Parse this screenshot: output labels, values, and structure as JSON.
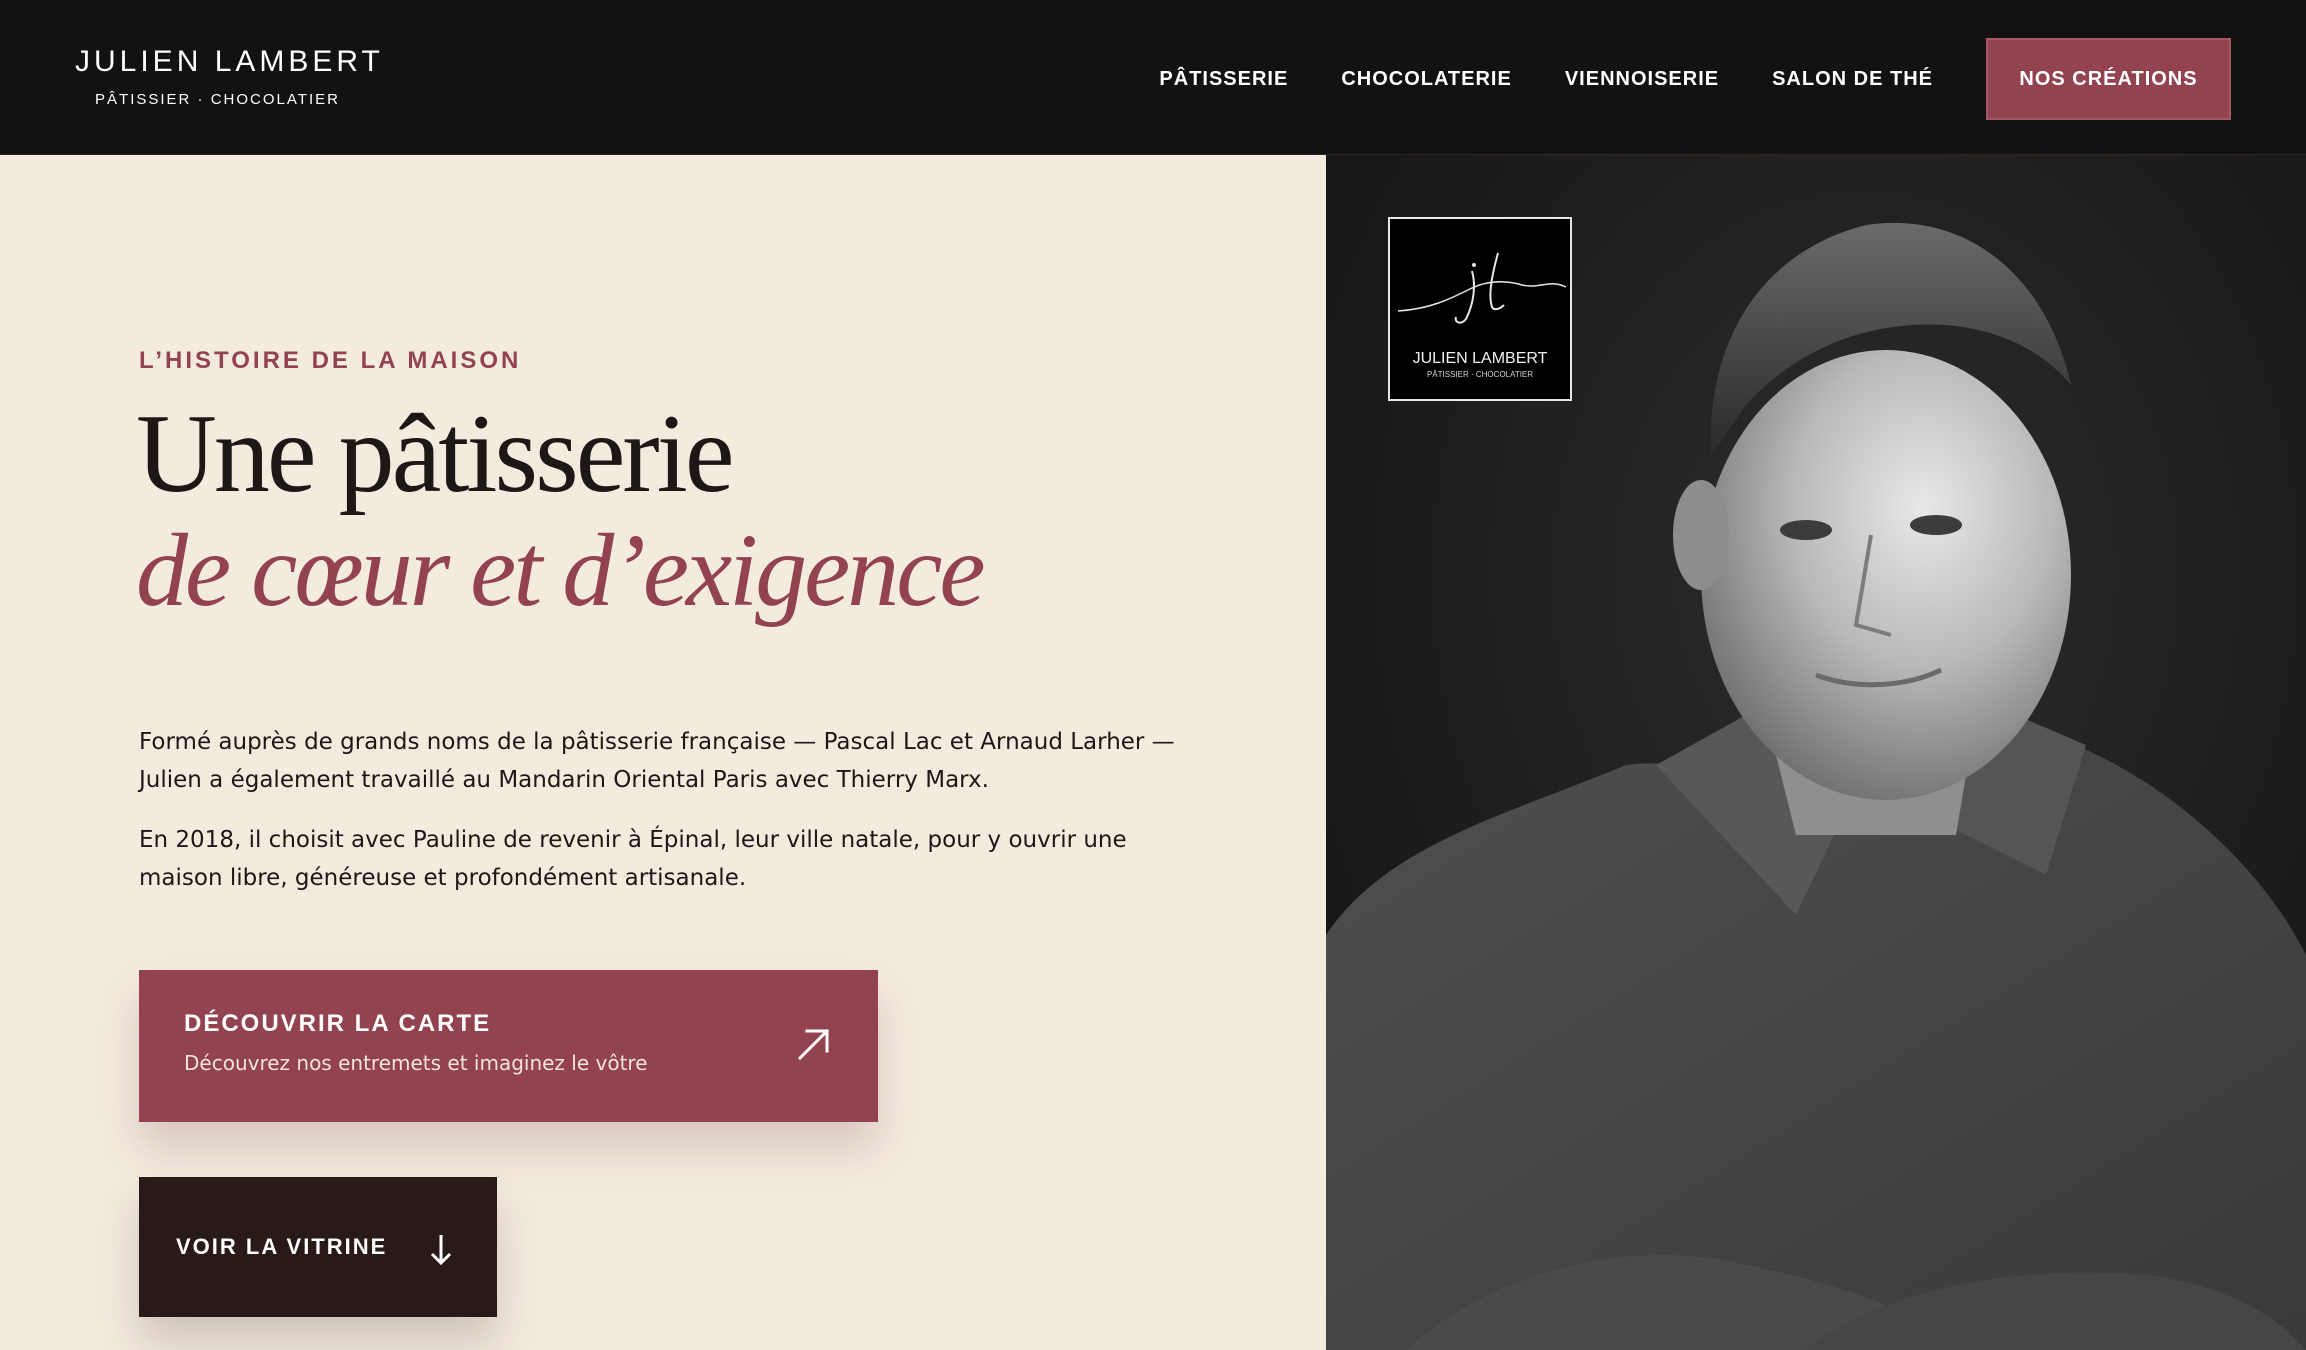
{
  "header": {
    "brand_name": "JULIEN LAMBERT",
    "brand_tagline": "PÂTISSIER · CHOCOLATIER",
    "nav": [
      {
        "label": "PÂTISSERIE"
      },
      {
        "label": "CHOCOLATERIE"
      },
      {
        "label": "VIENNOISERIE"
      },
      {
        "label": "SALON DE THÉ"
      }
    ],
    "cta_label": "NOS CRÉATIONS"
  },
  "hero": {
    "eyebrow": "L’HISTOIRE DE LA MAISON",
    "title_line1": "Une pâtisserie",
    "title_line2": "de cœur et d’exigence",
    "paragraph1": "Formé auprès de grands noms de la pâtisserie française — Pascal Lac et Arnaud Larher — Julien a également travaillé au Mandarin Oriental Paris avec Thierry Marx.",
    "paragraph2": "En 2018, il choisit avec Pauline de revenir à Épinal, leur ville natale, pour y ouvrir une maison libre, généreuse et profondément artisanale.",
    "primary_button": {
      "title": "DÉCOUVRIR LA CARTE",
      "subtitle": "Découvrez nos entremets et imaginez le vôtre",
      "icon": "arrow-up-right-icon"
    },
    "secondary_button": {
      "label": "VOIR LA VITRINE",
      "icon": "arrow-down-icon"
    }
  },
  "photo": {
    "logo": {
      "monogram": "jl",
      "name": "JULIEN LAMBERT",
      "tagline": "PÂTISSIER · CHOCOLATIER"
    }
  },
  "colors": {
    "header_bg": "#141211",
    "content_bg": "#f4ebdf",
    "accent": "#93434f",
    "dark_button": "#2a1a17",
    "text": "#1d1715"
  }
}
